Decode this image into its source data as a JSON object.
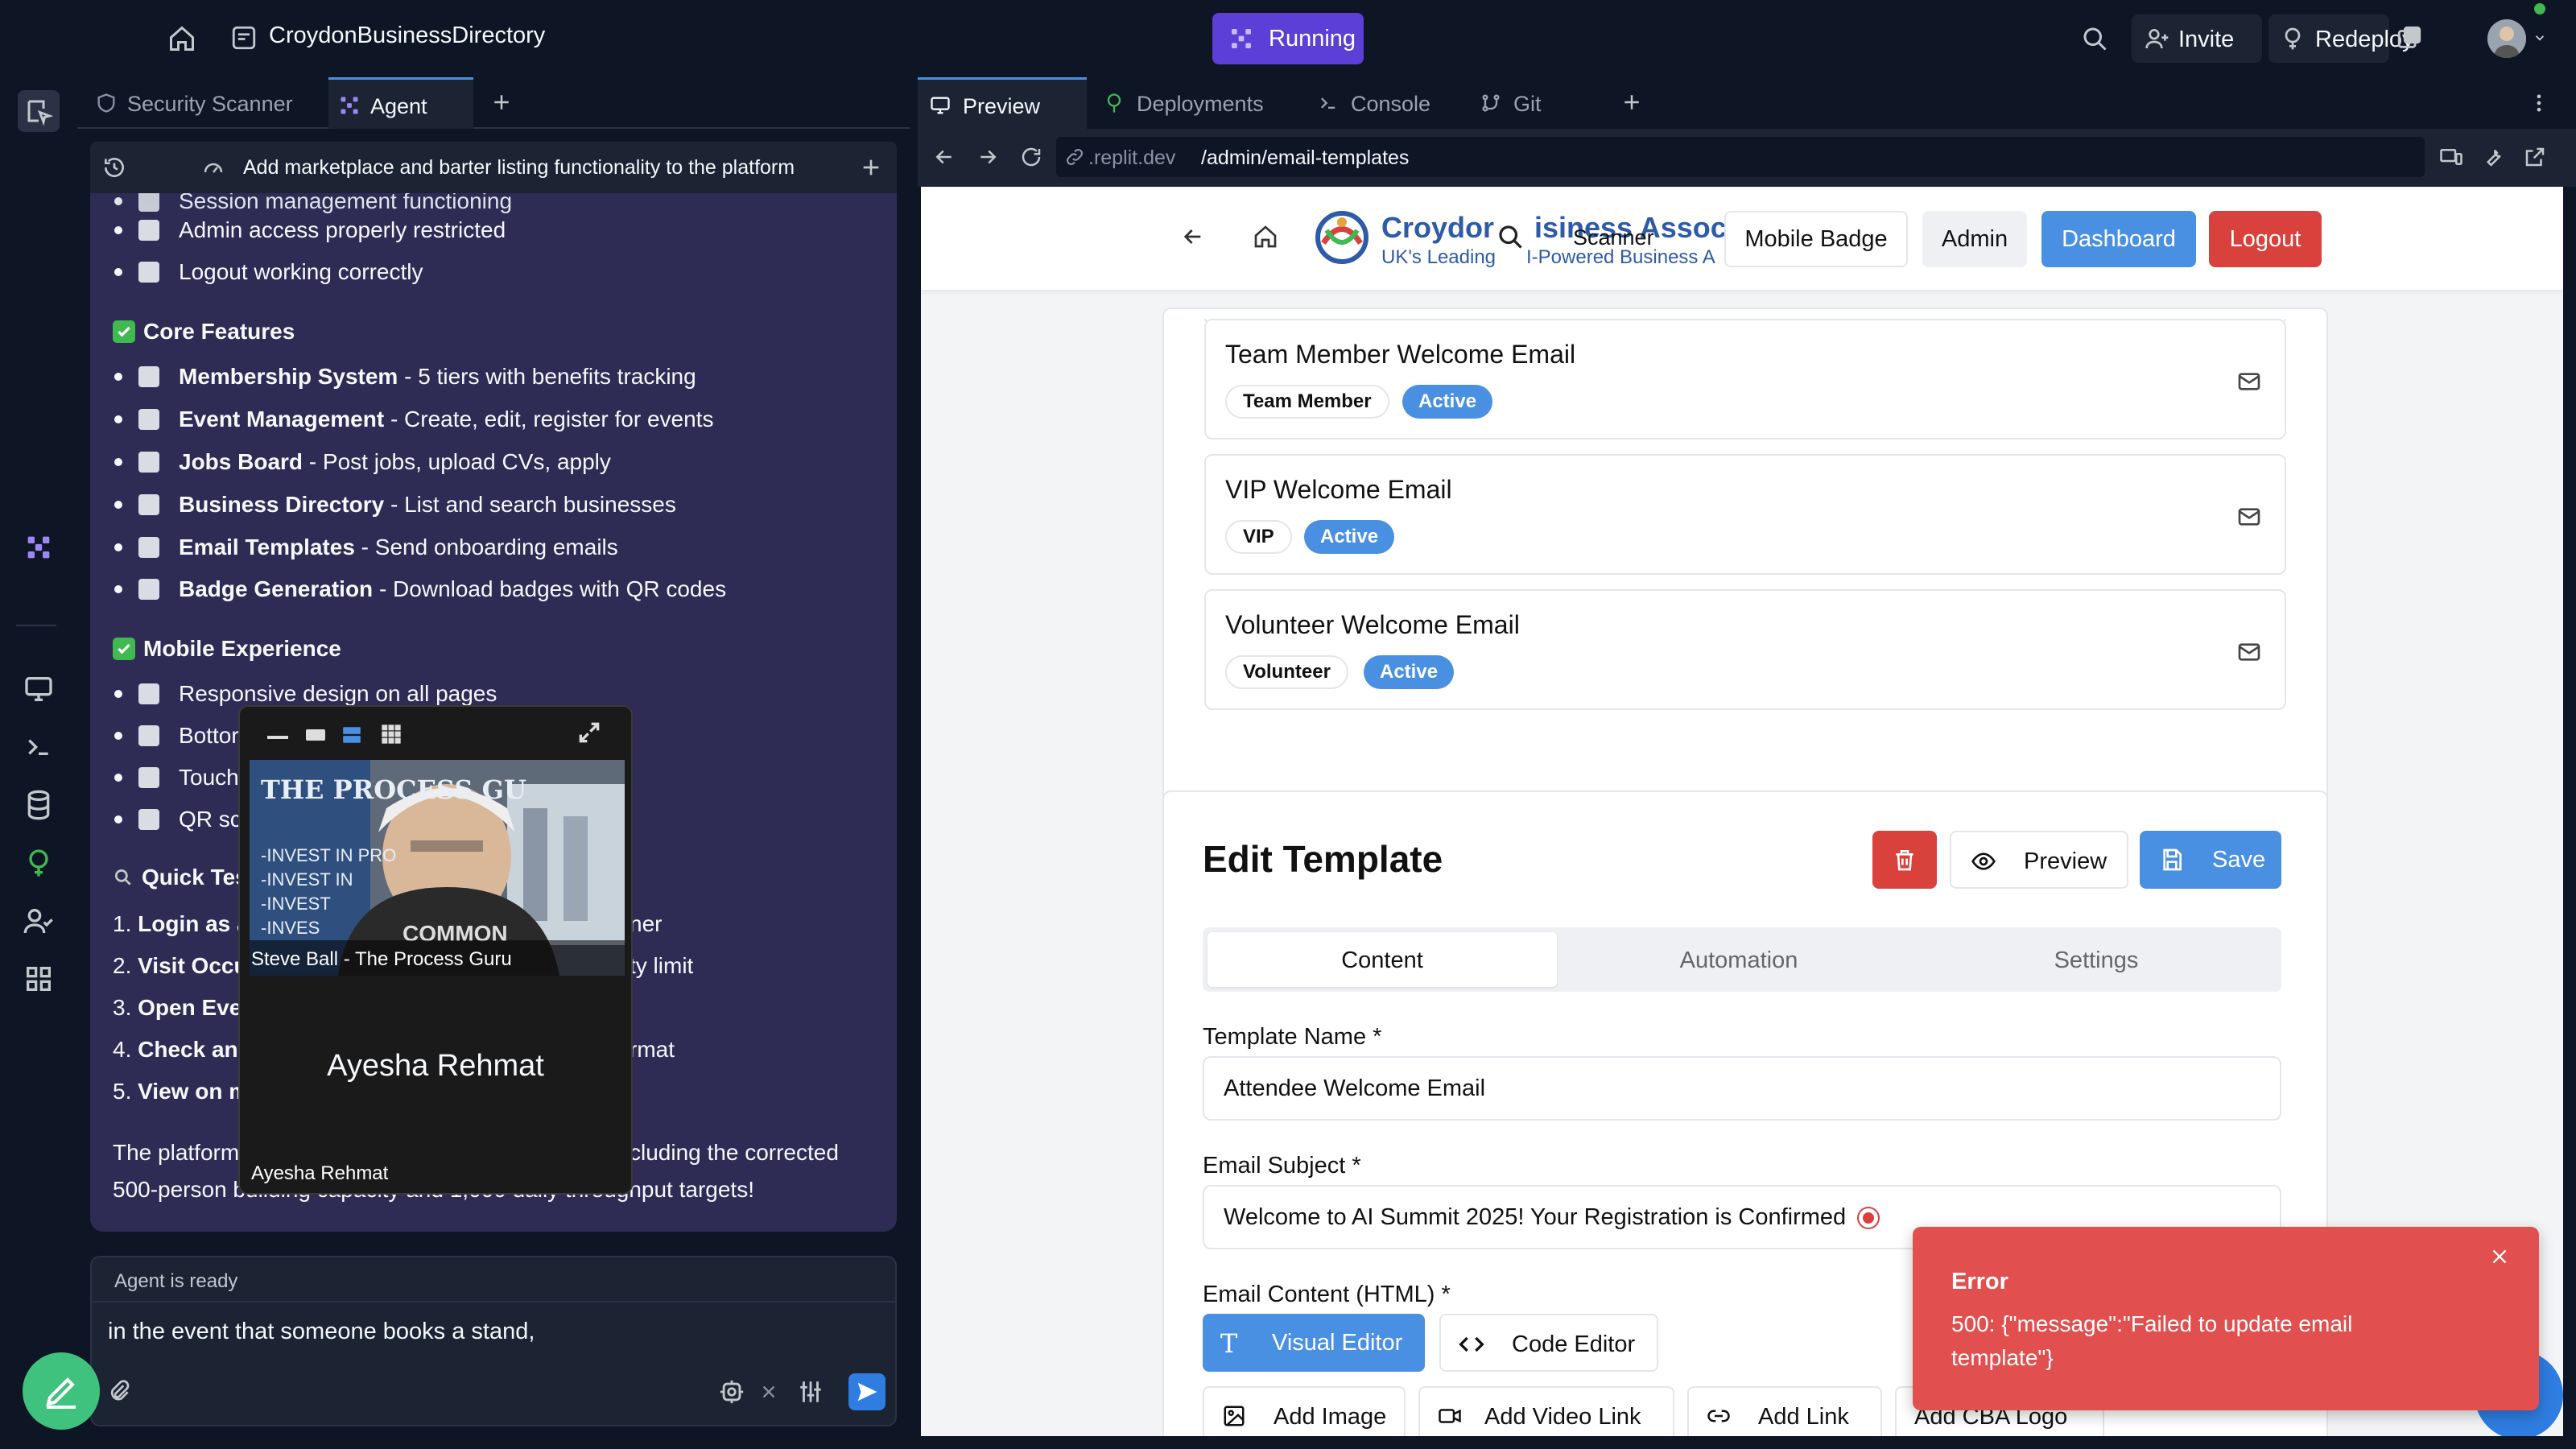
{
  "topbar": {
    "project_name": "CroydonBusinessDirectory",
    "run_label": "Running",
    "invite_label": "Invite",
    "redeploy_label": "Redeploy"
  },
  "left_tabs": {
    "tab1": "Security Scanner",
    "tab2": "Agent"
  },
  "agent": {
    "thread_title": "Add marketplace and barter listing functionality to the platform",
    "partial_top": "Session management functioning",
    "items_top": [
      "Admin access properly restricted",
      "Logout working correctly"
    ],
    "core_title": "Core Features",
    "core": [
      {
        "b": "Membership System",
        "t": " - 5 tiers with benefits tracking"
      },
      {
        "b": "Event Management",
        "t": " - Create, edit, register for events"
      },
      {
        "b": "Jobs Board",
        "t": " - Post jobs, upload CVs, apply"
      },
      {
        "b": "Business Directory",
        "t": " - List and search businesses"
      },
      {
        "b": "Email Templates",
        "t": " - Send onboarding emails"
      },
      {
        "b": "Badge Generation",
        "t": " - Download badges with QR codes"
      }
    ],
    "mobile_title": "Mobile Experience",
    "mobile": [
      "Responsive design on all pages",
      "Bottor",
      "Touch",
      "QR sca"
    ],
    "quick_title": "Quick Tes",
    "quick": [
      {
        "n": "1.",
        "b": "Login as a",
        "t": "ner"
      },
      {
        "n": "2.",
        "b": "Visit Occu",
        "t": "ty limit"
      },
      {
        "n": "3.",
        "b": "Open Ever",
        "t": ""
      },
      {
        "n": "4.",
        "b": "Check any",
        "t": "rmat"
      },
      {
        "n": "5.",
        "b": "View on m",
        "t": ""
      }
    ],
    "summary_1a": "The platform",
    "summary_1b": "cluding the corrected",
    "summary_2": "500-person building capacity and 1,000 daily throughput targets!",
    "status": "Agent is ready",
    "input_text": "in the event that someone books a stand,"
  },
  "video": {
    "person1": "Steve Ball - The Process Guru",
    "person2_big": "Ayesha Rehmat",
    "person2_tag": "Ayesha Rehmat",
    "shirt_text": "THE PROCESS GU",
    "poster_lines": [
      "-INVEST IN PRO",
      "-INVEST IN",
      "-INVEST",
      "-INVES"
    ],
    "shirt": "COMMON"
  },
  "right_tabs": {
    "preview": "Preview",
    "deployments": "Deployments",
    "console": "Console",
    "git": "Git"
  },
  "url": {
    "host": ".replit.dev",
    "path": "/admin/email-templates"
  },
  "site": {
    "brand": "Croydor",
    "brand2": "isiness Assoc",
    "tagline": "UK's Leading",
    "tagline2": "I-Powered Business A",
    "scanner": "Scanner",
    "mobile_badge": "Mobile Badge",
    "admin": "Admin",
    "dashboard": "Dashboard",
    "logout": "Logout",
    "templates": [
      {
        "title": "Team Member Welcome Email",
        "tag": "Team Member",
        "status": "Active"
      },
      {
        "title": "VIP Welcome Email",
        "tag": "VIP",
        "status": "Active"
      },
      {
        "title": "Volunteer Welcome Email",
        "tag": "Volunteer",
        "status": "Active"
      }
    ],
    "edit_title": "Edit Template",
    "preview_btn": "Preview",
    "save_btn": "Save",
    "tabs": [
      "Content",
      "Automation",
      "Settings"
    ],
    "name_label": "Template Name *",
    "name_value": "Attendee Welcome Email",
    "subject_label": "Email Subject *",
    "subject_value": "Welcome to AI Summit 2025! Your Registration is Confirmed",
    "content_label": "Email Content (HTML) *",
    "visual_editor": "Visual Editor",
    "code_editor": "Code Editor",
    "add_image": "Add Image",
    "add_video": "Add Video Link",
    "add_link": "Add Link",
    "add_logo": "Add CBA Logo"
  },
  "toast": {
    "title": "Error",
    "message": "500: {\"message\":\"Failed to update email template\"}"
  },
  "colors": {
    "accent": "#4a90e2",
    "danger": "#e24f4f",
    "running": "#5b3fd6",
    "agent_bg": "#2e2b55"
  }
}
